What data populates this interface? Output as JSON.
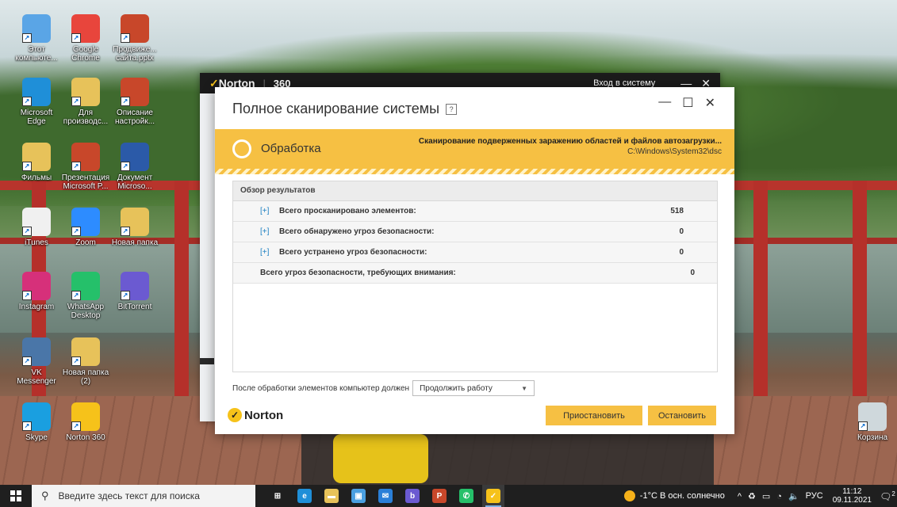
{
  "desktop_icons": [
    {
      "label": "Этот компьюте...",
      "icon": "computer-icon",
      "color": "#5aa5e6"
    },
    {
      "label": "Google Chrome",
      "icon": "chrome-icon",
      "color": "#e8453c"
    },
    {
      "label": "Продвиже... сайта.pptx",
      "icon": "powerpoint-file-icon",
      "color": "#c8472a"
    },
    {
      "label": "Microsoft Edge",
      "icon": "edge-icon",
      "color": "#1f8fd8"
    },
    {
      "label": "Для производс...",
      "icon": "folder-icon",
      "color": "#e7c25a"
    },
    {
      "label": "Описание настройк...",
      "icon": "powerpoint-file-icon",
      "color": "#c8472a"
    },
    {
      "label": "Фильмы",
      "icon": "folder-icon",
      "color": "#e7c25a"
    },
    {
      "label": "Презентация Microsoft P...",
      "icon": "powerpoint-file-icon",
      "color": "#c8472a"
    },
    {
      "label": "Документ Microso...",
      "icon": "word-file-icon",
      "color": "#2b5aa8"
    },
    {
      "label": "iTunes",
      "icon": "itunes-icon",
      "color": "#f0f0f0"
    },
    {
      "label": "Zoom",
      "icon": "zoom-icon",
      "color": "#2d8cff"
    },
    {
      "label": "Новая папка",
      "icon": "folder-icon",
      "color": "#e7c25a"
    },
    {
      "label": "Instagram",
      "icon": "instagram-icon",
      "color": "#d6307a"
    },
    {
      "label": "WhatsApp Desktop",
      "icon": "whatsapp-icon",
      "color": "#25c06a"
    },
    {
      "label": "BitTorrent",
      "icon": "bittorrent-icon",
      "color": "#6b5ad1"
    },
    {
      "label": "VK Messenger",
      "icon": "vk-icon",
      "color": "#4a76a8"
    },
    {
      "label": "Новая папка (2)",
      "icon": "folder-icon",
      "color": "#e7c25a"
    },
    {
      "label": "Skype",
      "icon": "skype-icon",
      "color": "#1a9fe0"
    },
    {
      "label": "Norton 360",
      "icon": "norton-icon",
      "color": "#f6c21a"
    },
    {
      "label": "Корзина",
      "icon": "recycle-bin-icon",
      "color": "#cfd8dc"
    }
  ],
  "bg_window": {
    "brand": "Norton",
    "product": "360",
    "login": "Вход в систему",
    "minimize": "—",
    "close": "✕"
  },
  "dialog": {
    "title": "Полное сканирование системы",
    "help": "?",
    "minimize": "—",
    "maximize": "☐",
    "close": "✕",
    "status": {
      "label": "Обработка",
      "task": "Сканирование подверженных заражению областей и файлов автозагрузки...",
      "path": "C:\\Windows\\System32\\dsc"
    },
    "results": {
      "header": "Обзор результатов",
      "rows": [
        {
          "expand": "[+]",
          "label": "Всего просканировано элементов:",
          "value": "518"
        },
        {
          "expand": "[+]",
          "label": "Всего обнаружено угроз безопасности:",
          "value": "0"
        },
        {
          "expand": "[+]",
          "label": "Всего устранено угроз безопасности:",
          "value": "0"
        },
        {
          "expand": "",
          "label": "Всего угроз безопасности, требующих внимания:",
          "value": "0"
        }
      ]
    },
    "after_label": "После обработки элементов компьютер должен",
    "after_value": "Продолжить работу",
    "brand": "Norton",
    "pause_label": "Приостановить",
    "stop_label": "Остановить",
    "accent": "#f6c043"
  },
  "taskbar": {
    "search_placeholder": "Введите здесь текст для поиска",
    "apps": [
      {
        "name": "task-view-icon",
        "glyph": "⊞",
        "color": "#ffffff"
      },
      {
        "name": "edge-icon",
        "glyph": "e",
        "color": "#1f8fd8"
      },
      {
        "name": "explorer-icon",
        "glyph": "▬",
        "color": "#e7c25a"
      },
      {
        "name": "store-icon",
        "glyph": "▣",
        "color": "#4a9fe0"
      },
      {
        "name": "mail-icon",
        "glyph": "✉",
        "color": "#2a7fd8"
      },
      {
        "name": "bittorrent-icon",
        "glyph": "b",
        "color": "#6b5ad1"
      },
      {
        "name": "powerpoint-icon",
        "glyph": "P",
        "color": "#c8472a"
      },
      {
        "name": "whatsapp-icon",
        "glyph": "✆",
        "color": "#25c06a"
      },
      {
        "name": "norton-icon",
        "glyph": "✓",
        "color": "#f6c21a"
      }
    ],
    "weather": "-1°C  В осн. солнечно",
    "tray": [
      "^",
      "♻",
      "▭",
      "◔",
      "🔈"
    ],
    "lang": "РУС",
    "time": "11:12",
    "date": "09.11.2021",
    "notifications_count": "2"
  }
}
